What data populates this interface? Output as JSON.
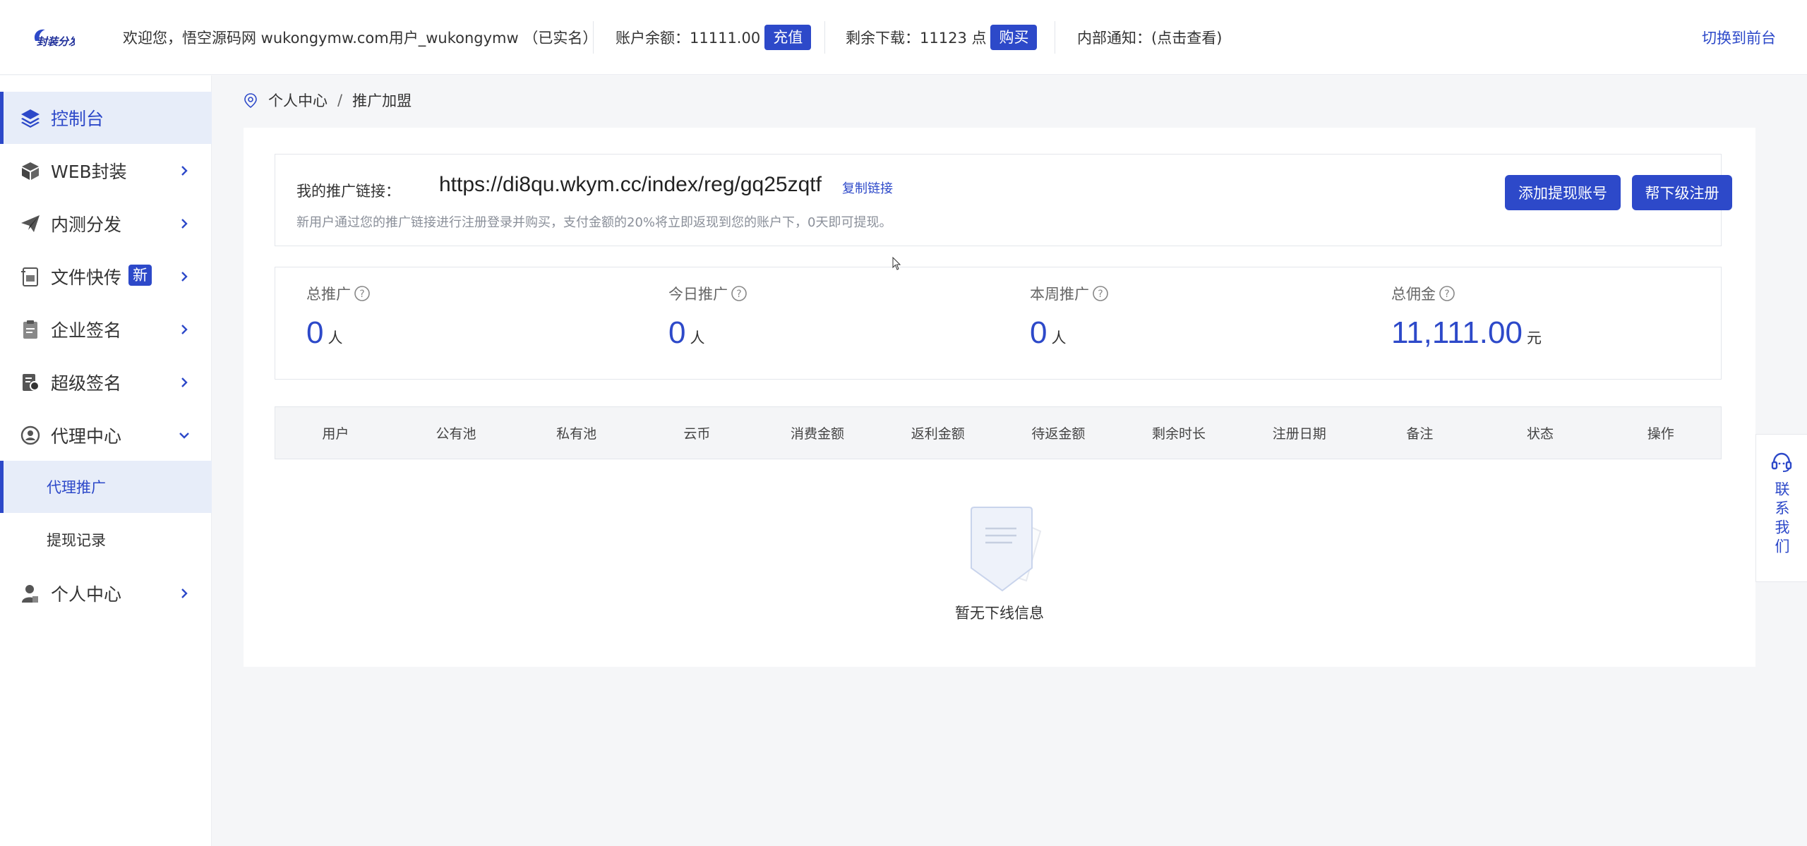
{
  "header": {
    "welcome": "欢迎您，悟空源码网 wukongymw.com用户_wukongymw （已实名）",
    "balance_label": "账户余额：11111.00",
    "recharge_label": "充值",
    "downloads_label": "剩余下载：11123 点",
    "buy_label": "购买",
    "notice_label": "内部通知：(点击查看)",
    "switch_label": "切换到前台",
    "logo_text": "封装分发"
  },
  "sidebar": {
    "items": [
      {
        "label": "控制台",
        "icon": "layers-icon"
      },
      {
        "label": "WEB封装",
        "icon": "box-icon"
      },
      {
        "label": "内测分发",
        "icon": "paper-plane-icon"
      },
      {
        "label": "文件快传",
        "icon": "file-transfer-icon",
        "badge": "新"
      },
      {
        "label": "企业签名",
        "icon": "clipboard-icon"
      },
      {
        "label": "超级签名",
        "icon": "certificate-icon"
      },
      {
        "label": "代理中心",
        "icon": "agent-icon"
      },
      {
        "label": "个人中心",
        "icon": "user-icon"
      }
    ],
    "subitems": [
      {
        "label": "代理推广"
      },
      {
        "label": "提现记录"
      }
    ]
  },
  "breadcrumb": {
    "level1": "个人中心",
    "separator": "/",
    "level2": "推广加盟"
  },
  "promo": {
    "link_label": "我的推广链接：",
    "link_url": "https://di8qu.wkym.cc/index/reg/gq25zqtf",
    "copy_label": "复制链接",
    "note": "新用户通过您的推广链接进行注册登录并购买，支付金额的20%将立即返现到您的账户下，0天即可提现。",
    "add_account_label": "添加提现账号",
    "register_label": "帮下级注册"
  },
  "stats": [
    {
      "label": "总推广",
      "value": "0",
      "unit": "人"
    },
    {
      "label": "今日推广",
      "value": "0",
      "unit": "人"
    },
    {
      "label": "本周推广",
      "value": "0",
      "unit": "人"
    },
    {
      "label": "总佣金",
      "value": "11,111.00",
      "unit": "元"
    }
  ],
  "table": {
    "columns": [
      "用户",
      "公有池",
      "私有池",
      "云币",
      "消费金额",
      "返利金额",
      "待返金额",
      "剩余时长",
      "注册日期",
      "备注",
      "状态",
      "操作"
    ]
  },
  "empty_text": "暂无下线信息",
  "contact_label": "联系我们",
  "colors": {
    "accent": "#2d49c9",
    "active_bg": "#e7edf9",
    "page_bg": "#f5f6f8"
  }
}
